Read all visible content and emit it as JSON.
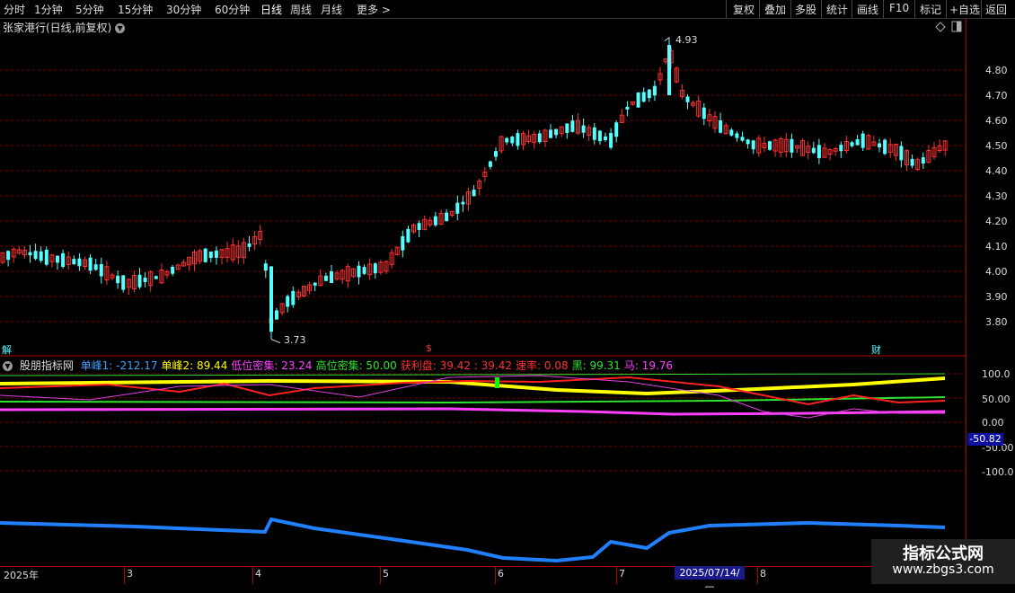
{
  "toolbar": {
    "left_items": [
      "分时",
      "1分钟",
      "5分钟",
      "15分钟",
      "30分钟",
      "60分钟",
      "日线",
      "周线",
      "月线",
      "更多 >"
    ],
    "right_items": [
      "复权",
      "叠加",
      "多股",
      "统计",
      "画线",
      "F10",
      "标记",
      "+自选",
      "返回"
    ]
  },
  "stock_title": "张家港行(日线,前复权)",
  "price_axis": [
    "4.80",
    "4.70",
    "4.60",
    "4.50",
    "4.40",
    "4.30",
    "4.20",
    "4.10",
    "4.00",
    "3.90",
    "3.80"
  ],
  "price_annotations": {
    "high": "4.93",
    "low": "3.73"
  },
  "indicator": {
    "name": "股朋指标网",
    "items": [
      {
        "label": "单峰1: -212.17",
        "color": "#3fa0ff"
      },
      {
        "label": "单峰2: 89.44",
        "color": "#ffff00"
      },
      {
        "label": "低位密集: 23.24",
        "color": "#ff40ff"
      },
      {
        "label": "高位密集: 50.00",
        "color": "#30e030"
      },
      {
        "label": "获利盘: 39.42 : 39.42",
        "color": "#ff3030"
      },
      {
        "label": "速率: 0.08",
        "color": "#ff3030"
      },
      {
        "label": "黑: 99.31",
        "color": "#30e030"
      },
      {
        "label": "马: 19.76",
        "color": "#ff40ff"
      }
    ]
  },
  "indicator_axis": [
    "100.0",
    "50.00",
    "0.00",
    "-50.00",
    "-100.0"
  ],
  "current_value_badge": "-50.82",
  "markers": {
    "left": "解",
    "mid": "$",
    "right": "财"
  },
  "date_axis": {
    "year": "2025年",
    "months": [
      "3",
      "4",
      "5",
      "6",
      "7",
      "8"
    ],
    "cursor": "2025/07/14/—"
  },
  "watermark": {
    "title": "指标公式网",
    "url": "www.zbgs3.com"
  },
  "colors": {
    "up": "#ff3030",
    "down": "#54ffff",
    "grid": "#800000",
    "axis": "#b00000"
  }
}
